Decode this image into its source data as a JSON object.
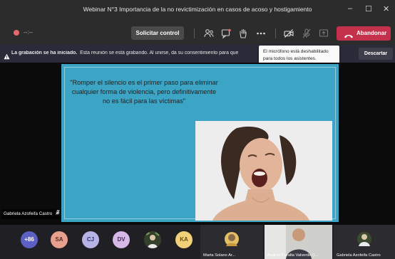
{
  "window": {
    "title": "Webinar N°3 Importancia de la no revictimización en casos de acoso y hostigamiento",
    "minimize": "–",
    "maximize": "☐",
    "close": "✕"
  },
  "toolbar": {
    "timer": "--:--",
    "control_button": "Solicitar control",
    "leave_button": "Abandonar"
  },
  "banner": {
    "bold_text": "La grabación se ha iniciado.",
    "text": "Esta reunión se está grabando. Al unirse, da su consentimiento para que",
    "dismiss_button": "Descartar"
  },
  "tooltip": {
    "line1": "El micrófono está deshabilitado",
    "line2": "para todos los asistentes."
  },
  "slide": {
    "quote": "\"Romper el silencio es el primer paso para eliminar cualquier forma de violencia, pero definitivamente no es fácil para las víctimas\""
  },
  "presenter": {
    "name": "Gabriela Azofeifa Castro"
  },
  "participants": {
    "overflow_count": "+86",
    "avatars": [
      {
        "initials": "SA",
        "bg": "#e8a08e",
        "fg": "#5a2a22"
      },
      {
        "initials": "CJ",
        "bg": "#b6b4e6",
        "fg": "#34306a"
      },
      {
        "initials": "DV",
        "bg": "#d6b9e6",
        "fg": "#4a2a5a"
      },
      {
        "initials": "KA",
        "bg": "#f2d07a",
        "fg": "#6a4a10"
      }
    ],
    "tiles": [
      {
        "name": "Marta Solano Ar..."
      },
      {
        "name": "Andrea Peralta Valverde (I..."
      },
      {
        "name": "Gabriela Azofeifa Castro"
      }
    ]
  },
  "colors": {
    "leave": "#c4314b",
    "slide_bg": "#3ca4c4",
    "banner_bg": "#2a2b38"
  }
}
